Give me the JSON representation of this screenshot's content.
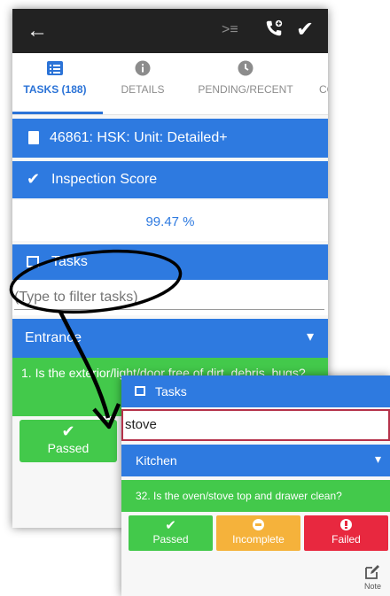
{
  "toolbar": {
    "back_icon": "arrow-left-icon",
    "list_icon": "list-indent-icon",
    "phone_icon": "phone-plus-icon",
    "done_icon": "check-icon"
  },
  "tabs": [
    {
      "label": "TASKS (188)",
      "icon": "list-icon",
      "active": true
    },
    {
      "label": "DETAILS",
      "icon": "info-icon",
      "active": false
    },
    {
      "label": "PENDING/RECENT",
      "icon": "clock-icon",
      "active": false
    },
    {
      "label": "CO",
      "icon": "",
      "active": false
    }
  ],
  "main": {
    "unit_header": "46861: HSK: Unit: Detailed+",
    "inspection_score_label": "Inspection Score",
    "inspection_score_value": "99.47 %",
    "tasks_label": "Tasks",
    "filter_placeholder": "(Type to filter tasks)",
    "section": "Entrance",
    "question": "1. Is the exterior/light/door free of dirt, debris, bugs?",
    "passed_label": "Passed"
  },
  "zoom": {
    "tasks_label": "Tasks",
    "filter_value": "stove",
    "section": "Kitchen",
    "question": "32. Is the oven/stove top and drawer clean?",
    "buttons": {
      "passed": "Passed",
      "incomplete": "Incomplete",
      "failed": "Failed"
    },
    "note_label": "Note"
  },
  "colors": {
    "accent_blue": "#2e7ae0",
    "pass_green": "#43c94b",
    "incomplete_orange": "#f5b23b",
    "failed_red": "#e8283f",
    "toolbar_dark": "#222222"
  }
}
